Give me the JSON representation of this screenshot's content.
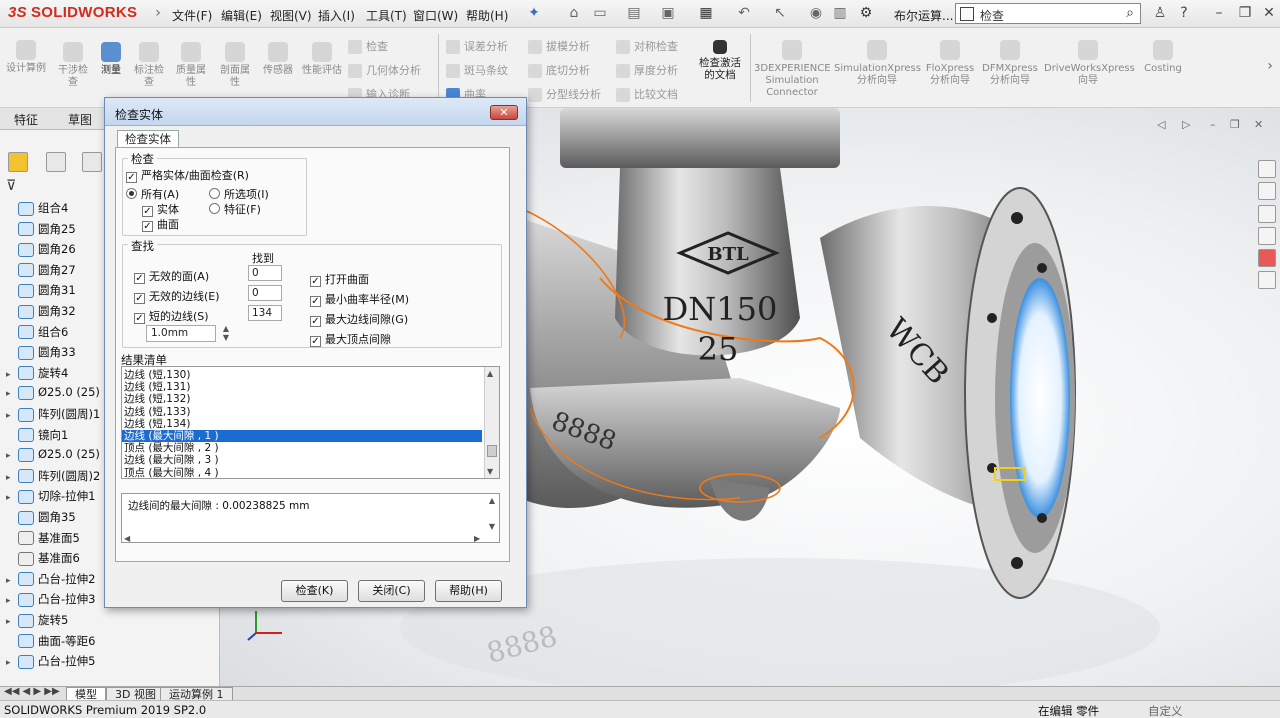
{
  "app": {
    "logo": "SOLIDWORKS",
    "logo_prefix": "3S",
    "menus": [
      "文件(F)",
      "编辑(E)",
      "视图(V)",
      "插入(I)",
      "工具(T)",
      "窗口(W)",
      "帮助(H)"
    ],
    "doc_title": "布尔运算...",
    "search_placeholder": "检查"
  },
  "commandbar": {
    "big_left": [
      "设计算例",
      "干涉检查",
      "测量",
      "标注检查",
      "质量属性",
      "剖面属性",
      "传感器",
      "性能评估"
    ],
    "col1": [
      "检查",
      "几何体分析",
      "输入诊断"
    ],
    "col2": [
      "误差分析",
      "斑马条纹",
      "曲率"
    ],
    "col3": [
      "拔模分析",
      "底切分析",
      "分型线分析"
    ],
    "col4": [
      "对称检查",
      "厚度分析",
      "比较文档"
    ],
    "check_active": "检查激活的文档",
    "right_tools": [
      "3DEXPERIENCE Simulation Connector",
      "SimulationXpress 分析向导",
      "FloXpress 分析向导",
      "DFMXpress 分析向导",
      "DriveWorksXpress 向导",
      "Costing"
    ]
  },
  "featuremanager": {
    "tabs": [
      "特征",
      "草图"
    ],
    "items": [
      {
        "label": "组合4",
        "icon": "body-icon"
      },
      {
        "label": "圆角25",
        "icon": "fillet-icon"
      },
      {
        "label": "圆角26",
        "icon": "fillet-icon"
      },
      {
        "label": "圆角27",
        "icon": "fillet-icon"
      },
      {
        "label": "圆角31",
        "icon": "fillet-icon"
      },
      {
        "label": "圆角32",
        "icon": "fillet-icon"
      },
      {
        "label": "组合6",
        "icon": "body-icon"
      },
      {
        "label": "圆角33",
        "icon": "fillet-icon"
      },
      {
        "label": "旋转4",
        "icon": "revolve-icon"
      },
      {
        "label": "Ø25.0 (25)",
        "icon": "hole-icon"
      },
      {
        "label": "阵列(圆周)1",
        "icon": "pattern-icon"
      },
      {
        "label": "镜向1",
        "icon": "mirror-icon"
      },
      {
        "label": "Ø25.0 (25)",
        "icon": "hole-icon"
      },
      {
        "label": "阵列(圆周)2",
        "icon": "pattern-icon"
      },
      {
        "label": "切除-拉伸1",
        "icon": "cut-icon"
      },
      {
        "label": "圆角35",
        "icon": "fillet-icon"
      },
      {
        "label": "基准面5",
        "icon": "plane-icon"
      },
      {
        "label": "基准面6",
        "icon": "plane-icon"
      },
      {
        "label": "凸台-拉伸2",
        "icon": "boss-icon"
      },
      {
        "label": "凸台-拉伸3",
        "icon": "boss-icon"
      },
      {
        "label": "旋转5",
        "icon": "revolve-icon"
      },
      {
        "label": "曲面-等距6",
        "icon": "surface-icon"
      },
      {
        "label": "凸台-拉伸5",
        "icon": "boss-icon"
      }
    ]
  },
  "dialog": {
    "title": "检查实体",
    "tab": "检查实体",
    "check_group": "检查",
    "strict": "严格实体/曲面检查(R)",
    "all": "所有(A)",
    "selected": "所选项(I)",
    "solid": "实体",
    "feature": "特征(F)",
    "surface": "曲面",
    "find_group": "查找",
    "found_header": "找到",
    "find_rows": [
      {
        "label": "无效的面(A)",
        "count": "0"
      },
      {
        "label": "无效的边线(E)",
        "count": "0"
      },
      {
        "label": "短的边线(S)",
        "count": "134"
      }
    ],
    "short_edge_value": "1.0mm",
    "right_checks": [
      "打开曲面",
      "最小曲率半径(M)",
      "最大边线间隙(G)",
      "最大顶点间隙"
    ],
    "results_title": "结果清单",
    "results": [
      "边线 (短,130)",
      "边线 (短,131)",
      "边线 (短,132)",
      "边线 (短,133)",
      "边线 (短,134)",
      "边线 (最大间隙 , 1 )",
      "顶点 (最大间隙 , 2 )",
      "边线 (最大间隙 , 3 )",
      "顶点 (最大间隙 , 4 )"
    ],
    "selected_index": 5,
    "detail": "边线间的最大间隙 : 0.00238825 mm",
    "buttons": {
      "check": "检查(K)",
      "close": "关闭(C)",
      "help": "帮助(H)"
    }
  },
  "model_text": {
    "brand": "BTL",
    "size": "DN150",
    "pressure": "25",
    "material": "WCB",
    "cast_number": "8888"
  },
  "bottom_tabs": [
    "模型",
    "3D 视图",
    "运动算例 1"
  ],
  "status": {
    "product": "SOLIDWORKS Premium 2019 SP2.0",
    "mode": "在编辑 零件",
    "custom": "自定义"
  },
  "colors": {
    "selection": "#1c6bd1",
    "highlight_edge": "#f07a1a",
    "brand_red": "#d42b1e"
  }
}
